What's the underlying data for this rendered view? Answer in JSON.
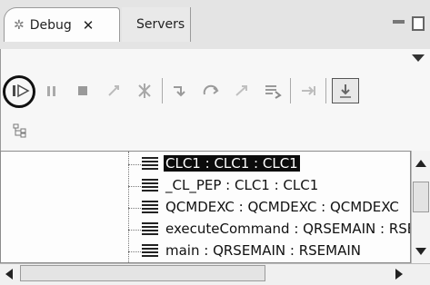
{
  "tabs": [
    {
      "label": "Debug",
      "close": "✕"
    },
    {
      "label": "Servers"
    }
  ],
  "toolbar": {
    "buttons": [
      {
        "name": "resume",
        "glyph": "⏵",
        "enabled": true
      },
      {
        "name": "suspend",
        "glyph": "⏸",
        "enabled": false
      },
      {
        "name": "terminate",
        "glyph": "■",
        "enabled": false
      },
      {
        "name": "disconnect",
        "glyph": "⟜",
        "enabled": false
      },
      {
        "name": "remove-terminated",
        "glyph": "✱",
        "enabled": false
      },
      {
        "name": "step-into",
        "glyph": "↘",
        "enabled": false
      },
      {
        "name": "step-over",
        "glyph": "↷",
        "enabled": false
      },
      {
        "name": "step-return",
        "glyph": "↗",
        "enabled": false
      },
      {
        "name": "drop-to-frame",
        "glyph": "≡",
        "enabled": false
      },
      {
        "name": "use-step-filters",
        "glyph": "⇥",
        "enabled": false
      },
      {
        "name": "instruction-stepping",
        "glyph": "⇣",
        "enabled": true
      }
    ]
  },
  "stack_frames": [
    {
      "label": "CLC1 : CLC1 : CLC1",
      "selected": true
    },
    {
      "label": "_CL_PEP : CLC1 : CLC1",
      "selected": false
    },
    {
      "label": "QCMDEXC : QCMDEXC : QCMDEXC",
      "selected": false
    },
    {
      "label": "executeCommand : QRSEMAIN : RSEMA",
      "selected": false
    },
    {
      "label": "main : QRSEMAIN : RSEMAIN",
      "selected": false
    }
  ],
  "colors": {
    "selection_bg": "#0b0b0b",
    "selection_fg": "#ffffff",
    "panel_bg": "#f7f7f7"
  }
}
